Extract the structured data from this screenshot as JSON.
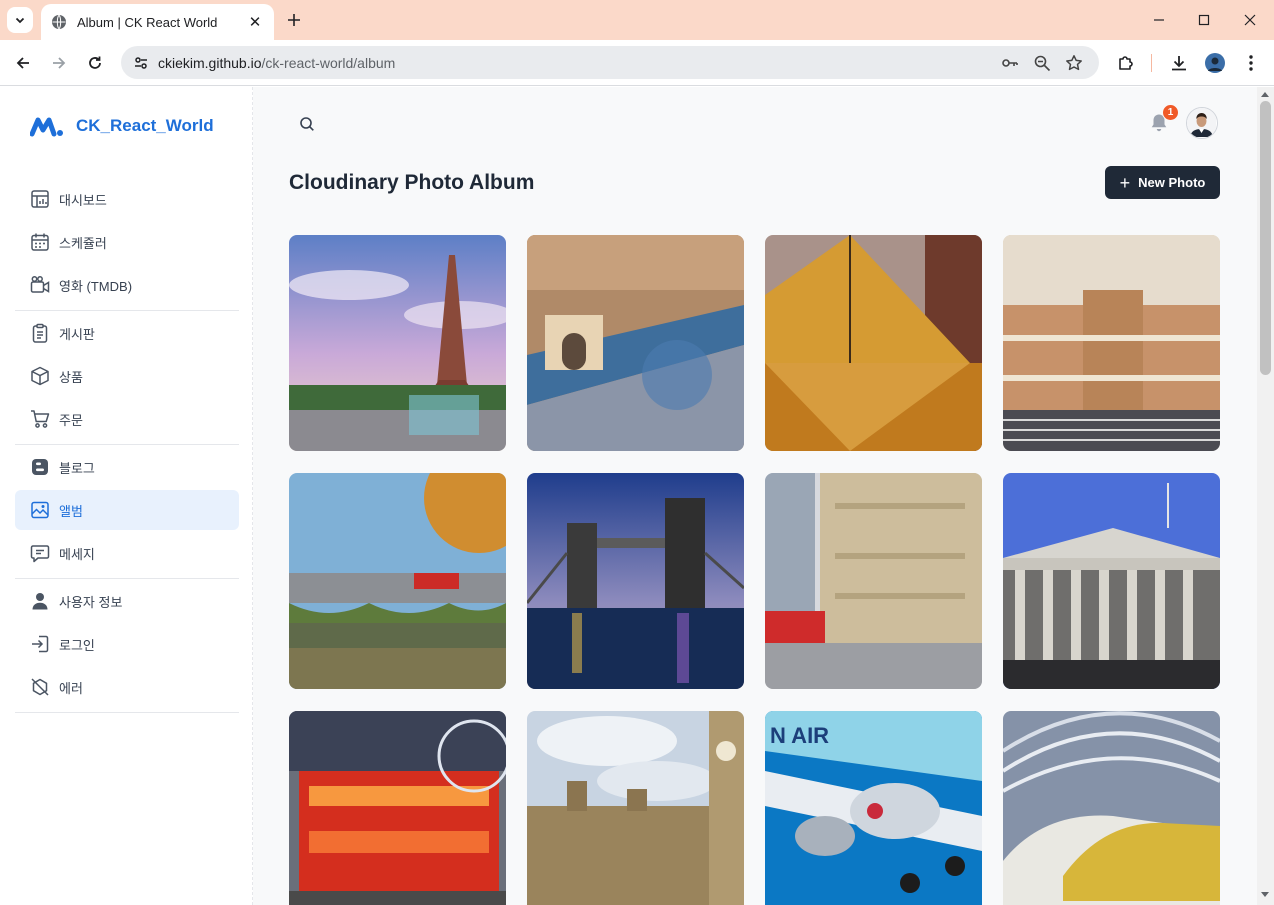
{
  "browser": {
    "tab_title": "Album | CK React World",
    "url_host": "ckiekim.github.io",
    "url_path": "/ck-react-world/album"
  },
  "sidebar": {
    "brand": "CK_React_World",
    "groups": [
      [
        {
          "label": "대시보드",
          "icon": "dashboard-icon"
        },
        {
          "label": "스케쥴러",
          "icon": "calendar-icon"
        },
        {
          "label": "영화 (TMDB)",
          "icon": "video-camera-icon"
        }
      ],
      [
        {
          "label": "게시판",
          "icon": "clipboard-icon"
        },
        {
          "label": "상품",
          "icon": "box-icon"
        },
        {
          "label": "주문",
          "icon": "cart-icon"
        }
      ],
      [
        {
          "label": "블로그",
          "icon": "blogger-icon"
        },
        {
          "label": "앨범",
          "icon": "image-icon",
          "active": true
        },
        {
          "label": "메세지",
          "icon": "message-icon"
        }
      ],
      [
        {
          "label": "사용자 정보",
          "icon": "user-icon"
        },
        {
          "label": "로그인",
          "icon": "login-icon"
        },
        {
          "label": "에러",
          "icon": "error-icon"
        }
      ]
    ]
  },
  "header": {
    "notification_count": "1"
  },
  "main": {
    "title": "Cloudinary Photo Album",
    "new_photo_label": "New Photo",
    "photos": [
      {
        "subject": "Eiffel Tower"
      },
      {
        "subject": "Arc de Triomphe aerial"
      },
      {
        "subject": "Louvre Pyramid"
      },
      {
        "subject": "Palace of Versailles"
      },
      {
        "subject": "Westminster Bridge"
      },
      {
        "subject": "Tower Bridge at night"
      },
      {
        "subject": "London street"
      },
      {
        "subject": "British Museum"
      },
      {
        "subject": "Red double-decker bus"
      },
      {
        "subject": "Big Ben and Parliament"
      },
      {
        "subject": "Korean Air airplane"
      },
      {
        "subject": "Eurostar trains"
      }
    ]
  },
  "colors": {
    "accent": "#1e6fd9",
    "active_bg": "#e8f1fd",
    "button_dark": "#1f2937",
    "badge": "#f05a28",
    "tabbar": "#fbd9c9"
  }
}
